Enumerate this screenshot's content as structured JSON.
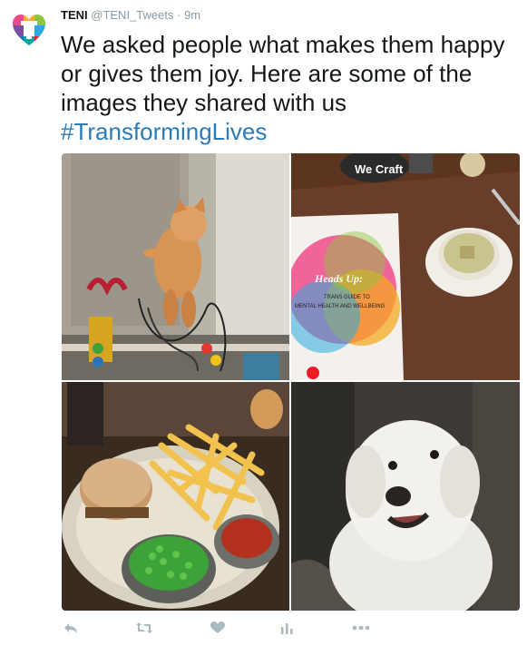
{
  "tweet": {
    "author_name": "TENI",
    "author_handle": "@TENI_Tweets",
    "separator": "·",
    "time": "9m",
    "text": "We asked people what makes them happy or gives them joy. Here are some of the images they shared with us",
    "hashtag": "#TransformingLives"
  },
  "media": {
    "photo1": {
      "icon": "cat-window-photo"
    },
    "photo2": {
      "icon": "booklet-tea-photo",
      "booklet_title": "Heads Up:",
      "booklet_subtitle_1": "TRANS GUIDE TO",
      "booklet_subtitle_2": "MENTAL HEALTH AND WELLBEING",
      "coaster_text": "We Craft"
    },
    "photo3": {
      "icon": "burger-fries-photo"
    },
    "photo4": {
      "icon": "white-dog-photo"
    }
  },
  "actions": {
    "reply_icon": "reply-icon",
    "retweet_icon": "retweet-icon",
    "like_icon": "heart-icon",
    "analytics_icon": "analytics-icon",
    "more_icon": "more-icon"
  },
  "colors": {
    "hashtag": "#2b7bb9",
    "muted": "#8899a6",
    "action_icon": "#aab8c2"
  }
}
